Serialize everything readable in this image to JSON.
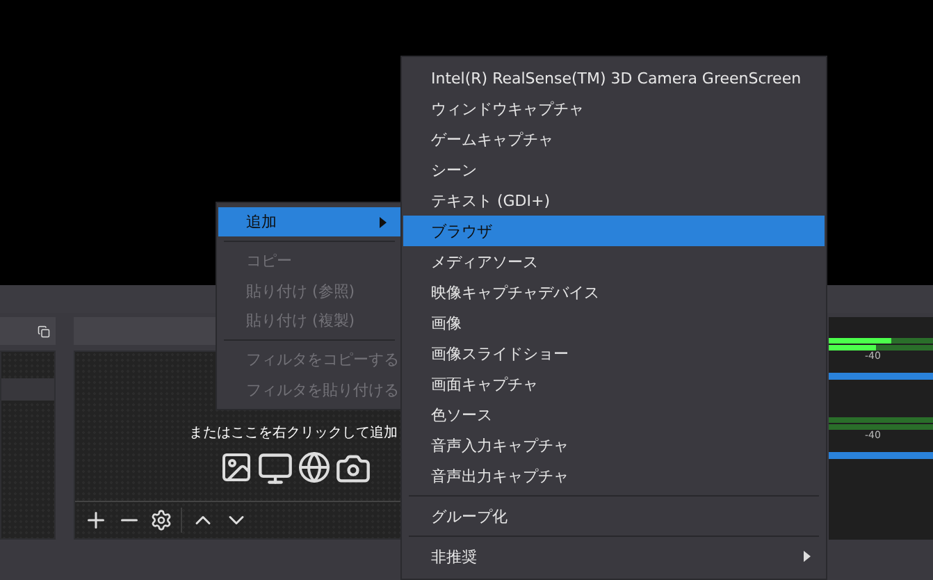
{
  "sources_hint": "またはここを右クリックして追加",
  "mixer": [
    {
      "meters": [
        {
          "level": 0.6
        },
        {
          "level": 0.45
        }
      ],
      "tick": "-40",
      "volume": {
        "level": 1
      }
    },
    {
      "tick": "-40",
      "volume": {
        "level": 1
      }
    }
  ],
  "context_menu": {
    "items": [
      {
        "kind": "item",
        "label": "追加",
        "selected": true,
        "disabled": false,
        "submenu": true
      },
      {
        "kind": "separator"
      },
      {
        "kind": "item",
        "label": "コピー",
        "selected": false,
        "disabled": true,
        "submenu": false
      },
      {
        "kind": "item",
        "label": "貼り付け (参照)",
        "selected": false,
        "disabled": true,
        "submenu": false
      },
      {
        "kind": "item",
        "label": "貼り付け (複製)",
        "selected": false,
        "disabled": true,
        "submenu": false
      },
      {
        "kind": "separator"
      },
      {
        "kind": "item",
        "label": "フィルタをコピーする",
        "selected": false,
        "disabled": true,
        "submenu": false
      },
      {
        "kind": "item",
        "label": "フィルタを貼り付ける",
        "selected": false,
        "disabled": true,
        "submenu": false
      }
    ]
  },
  "submenu": {
    "items": [
      {
        "kind": "item",
        "label": "Intel(R) RealSense(TM) 3D Camera GreenScreen",
        "selected": false,
        "submenu": false
      },
      {
        "kind": "item",
        "label": "ウィンドウキャプチャ",
        "selected": false,
        "submenu": false
      },
      {
        "kind": "item",
        "label": "ゲームキャプチャ",
        "selected": false,
        "submenu": false
      },
      {
        "kind": "item",
        "label": "シーン",
        "selected": false,
        "submenu": false
      },
      {
        "kind": "item",
        "label": "テキスト (GDI+)",
        "selected": false,
        "submenu": false
      },
      {
        "kind": "item",
        "label": "ブラウザ",
        "selected": true,
        "submenu": false
      },
      {
        "kind": "item",
        "label": "メディアソース",
        "selected": false,
        "submenu": false
      },
      {
        "kind": "item",
        "label": "映像キャプチャデバイス",
        "selected": false,
        "submenu": false
      },
      {
        "kind": "item",
        "label": "画像",
        "selected": false,
        "submenu": false
      },
      {
        "kind": "item",
        "label": "画像スライドショー",
        "selected": false,
        "submenu": false
      },
      {
        "kind": "item",
        "label": "画面キャプチャ",
        "selected": false,
        "submenu": false
      },
      {
        "kind": "item",
        "label": "色ソース",
        "selected": false,
        "submenu": false
      },
      {
        "kind": "item",
        "label": "音声入力キャプチャ",
        "selected": false,
        "submenu": false
      },
      {
        "kind": "item",
        "label": "音声出力キャプチャ",
        "selected": false,
        "submenu": false
      },
      {
        "kind": "separator"
      },
      {
        "kind": "item",
        "label": "グループ化",
        "selected": false,
        "submenu": false
      },
      {
        "kind": "separator"
      },
      {
        "kind": "item",
        "label": "非推奨",
        "selected": false,
        "submenu": true
      }
    ]
  }
}
